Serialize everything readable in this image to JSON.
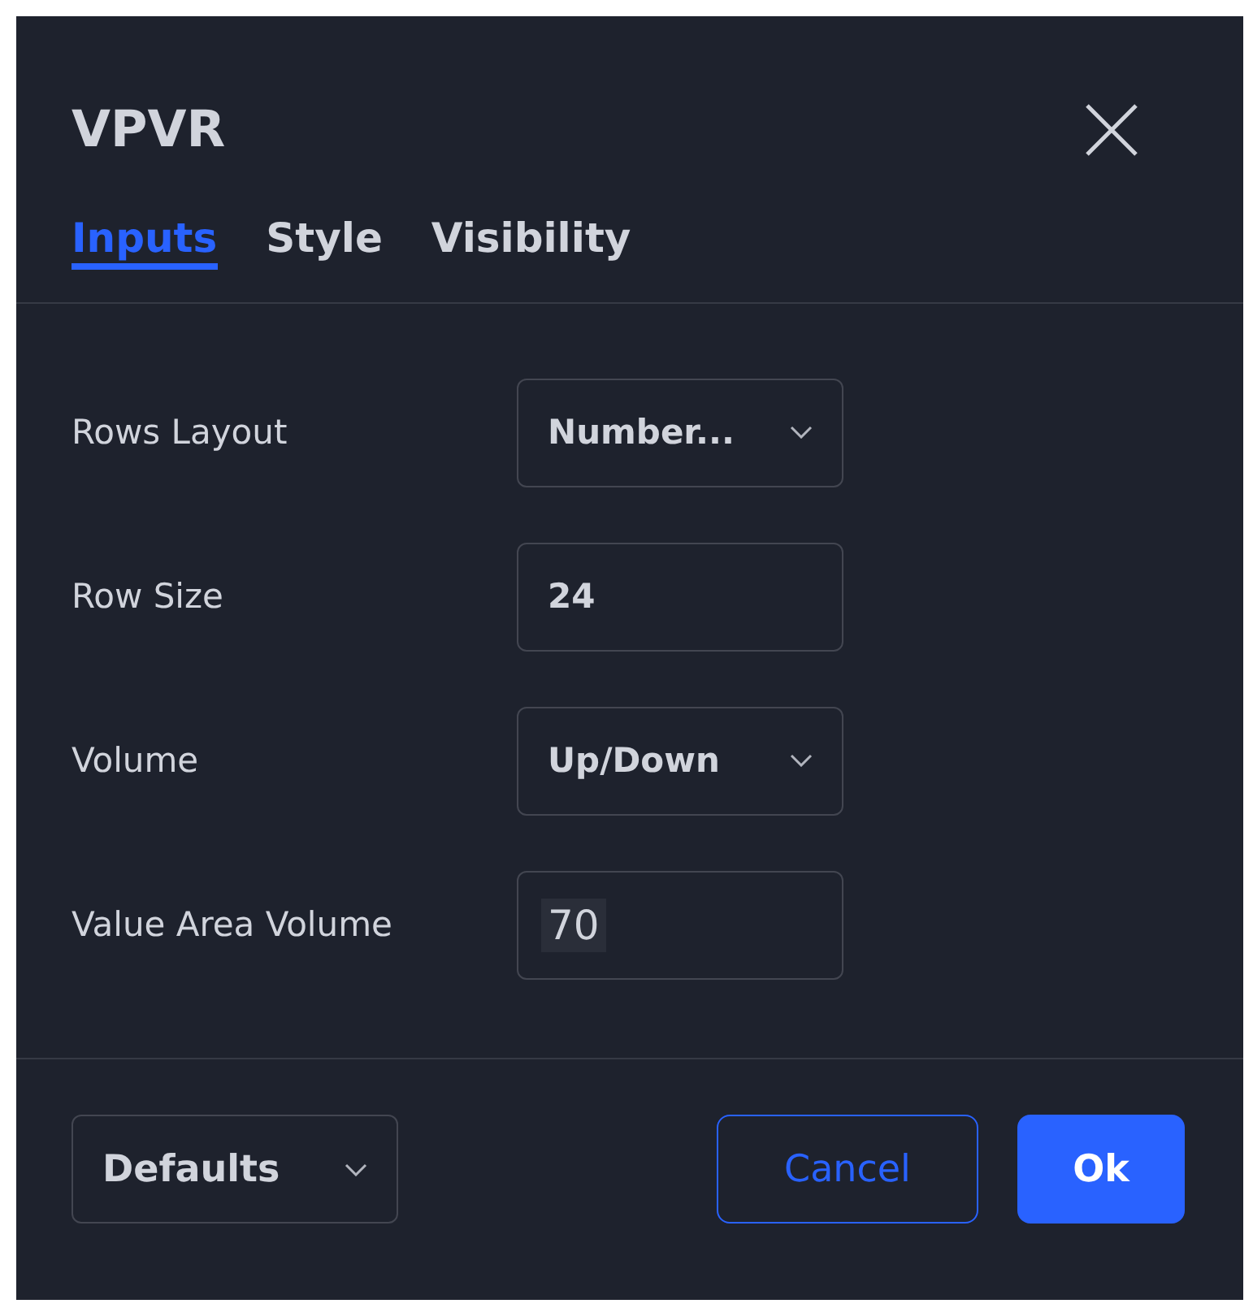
{
  "dialog": {
    "title": "VPVR"
  },
  "tabs": [
    {
      "label": "Inputs",
      "selected": true
    },
    {
      "label": "Style",
      "selected": false
    },
    {
      "label": "Visibility",
      "selected": false
    }
  ],
  "inputs": [
    {
      "label": "Rows Layout",
      "kind": "dropdown",
      "value": "Number..."
    },
    {
      "label": "Row Size",
      "kind": "number",
      "value": "24"
    },
    {
      "label": "Volume",
      "kind": "dropdown",
      "value": "Up/Down"
    },
    {
      "label": "Value Area Volume",
      "kind": "number",
      "value": "70",
      "highlighted": true
    }
  ],
  "footer": {
    "defaults": "Defaults",
    "cancel": "Cancel",
    "ok": "Ok"
  }
}
